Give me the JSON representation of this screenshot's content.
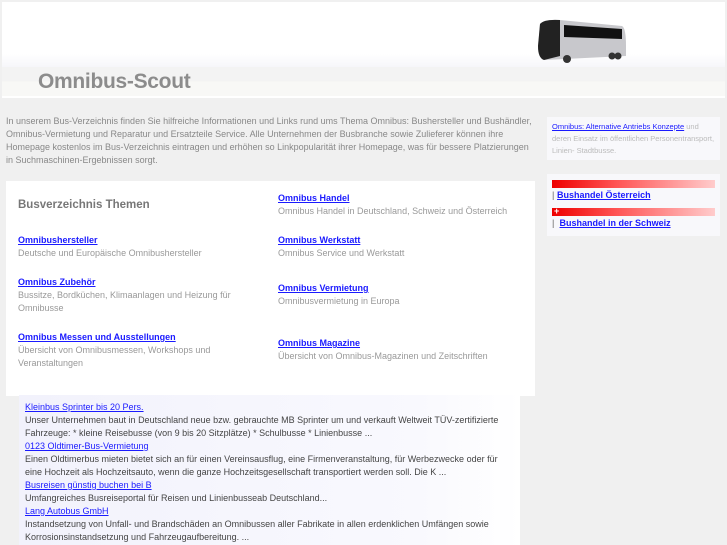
{
  "header": {
    "title": "Omnibus-Scout"
  },
  "intro": "In unserem Bus-Verzeichnis finden Sie hilfreiche Informationen und Links rund ums Thema Omnibus: Bushersteller und Bushändler, Omnibus-Vermietung und Reparatur und Ersatzteile Service.  Alle Unternehmen der Busbranche sowie Zulieferer können ihre Homepage kostenlos im Bus-Verzeichnis eintragen und erhöhen so Linkpopularität ihrer Homepage, was für bessere Platzierungen in Suchmaschinen-Ergebnissen sorgt.",
  "themes": {
    "heading": "Busverzeichnis Themen",
    "left": [
      {
        "label": "Omnibushersteller",
        "desc": "Deutsche und Europäische Omnibushersteller"
      },
      {
        "label": "Omnibus Zubehör",
        "desc": "Bussitze, Bordküchen, Klimaanlagen und Heizung für Omnibusse"
      },
      {
        "label": "Omnibus Messen und Ausstellungen",
        "desc": "Übersicht von Omnibusmessen, Workshops und Veranstaltungen"
      }
    ],
    "right": [
      {
        "label": "Omnibus Handel",
        "desc": "Omnibus Handel in Deutschland, Schweiz und Österreich"
      },
      {
        "label": "Omnibus Werkstatt",
        "desc": "Omnibus Service und Werkstatt"
      },
      {
        "label": "Omnibus Vermietung",
        "desc": "Omnibusvermietung in Europa"
      },
      {
        "label": "Omnibus Magazine",
        "desc": "Übersicht von Omnibus-Magazinen und Zeitschriften"
      }
    ]
  },
  "ads": [
    {
      "title": "Kleinbus Sprinter bis 20 Pers.",
      "text": "Unser Unternehmen baut in Deutschland neue bzw. gebrauchte MB Sprinter um und verkauft Weltweit TÜV-zertifizierte Fahrzeuge: * kleine Reisebusse (von 9 bis 20 Sitzplätze) * Schulbusse * Linienbusse ..."
    },
    {
      "title": "0123 Oldtimer-Bus-Vermietung",
      "text": "Einen Oldtimerbus mieten bietet sich an für einen Vereinsausflug, eine Firmenveranstaltung, für Werbezwecke oder für eine Hochzeit als Hochzeitsauto, wenn die ganze Hochzeitsgesellschaft transportiert werden soll. Die K ..."
    },
    {
      "title": "Busreisen günstig buchen bei B",
      "text": "Umfangreiches Busreiseportal für Reisen und Linienbusseab Deutschland..."
    },
    {
      "title": "Lang Autobus GmbH",
      "text": "Instandsetzung von Unfall- und Brandschäden an Omnibussen aller Fabrikate in allen erdenklichen Umfängen sowie Korrosionsinstandsetzung und Fahrzeugaufbereitung. ..."
    }
  ],
  "sidebar": {
    "promo_link": "Omnibus: Alternative Antriebs Konzepte",
    "promo_text": " und deren Einsatz im öffentlichen Personentransport, Linien- Stadtbusse.",
    "sep": "|",
    "links": [
      "Bushandel Österreich",
      "Bushandel in der Schweiz"
    ],
    "flag_cross": "+"
  }
}
